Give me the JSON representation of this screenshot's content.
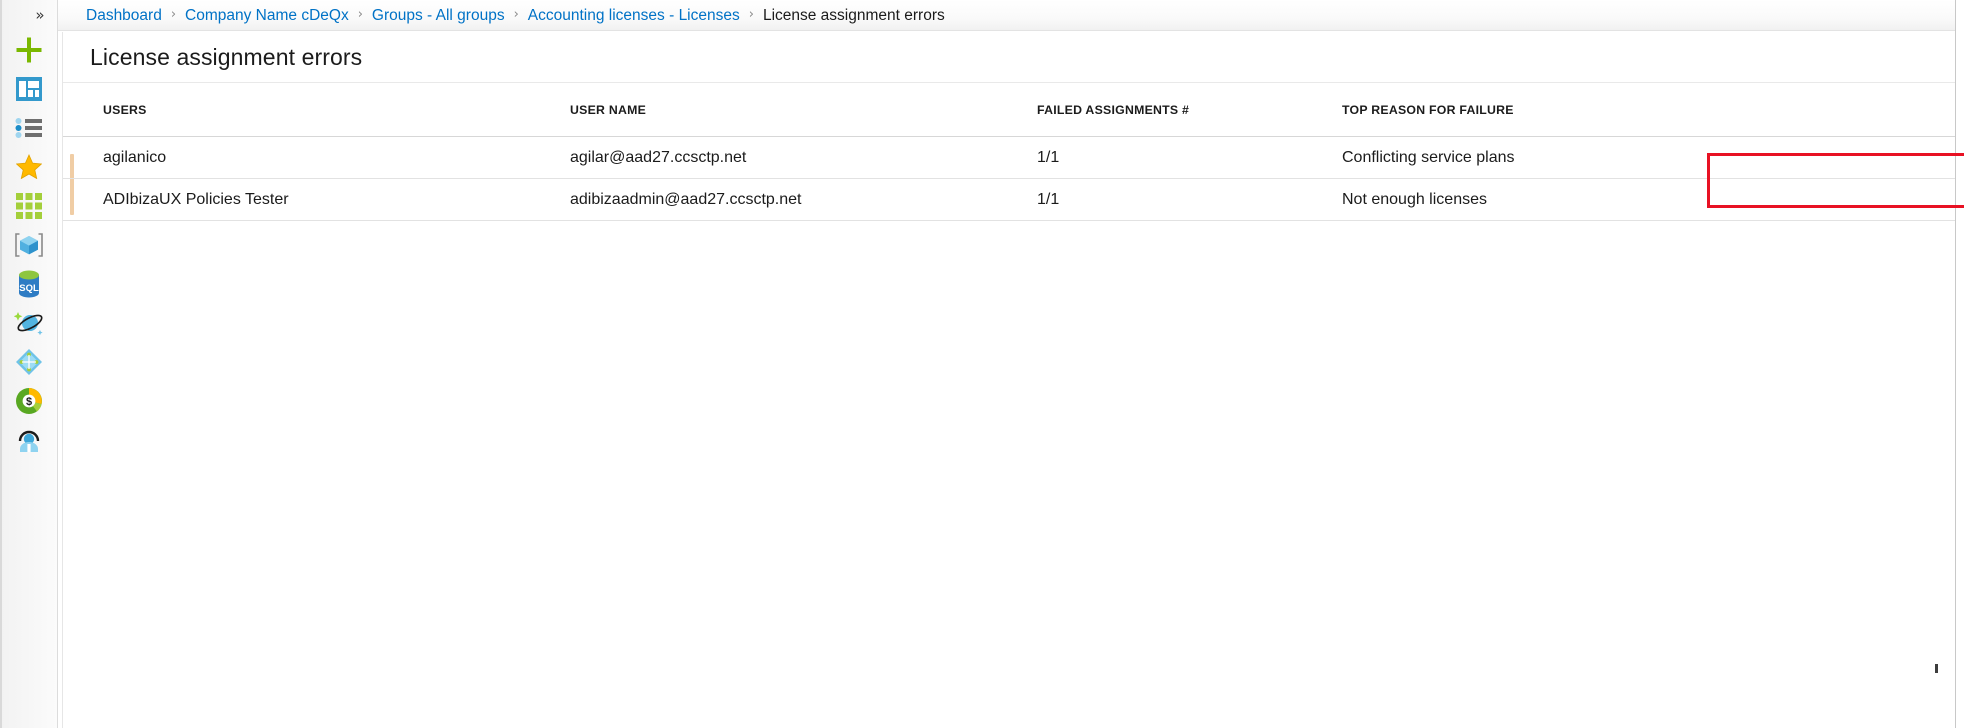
{
  "rail": {
    "collapse_label": "»",
    "items": [
      {
        "name": "create-resource",
        "icon": "plus-icon",
        "label": "Create a resource"
      },
      {
        "name": "dashboard",
        "icon": "dashboard-icon",
        "label": "Dashboard"
      },
      {
        "name": "all-services",
        "icon": "all-services-list-icon",
        "label": "All services"
      },
      {
        "name": "favorites",
        "icon": "star-icon",
        "label": "Favorites"
      },
      {
        "name": "all-resources",
        "icon": "grid-tiles-icon",
        "label": "All resources"
      },
      {
        "name": "resource-groups",
        "icon": "cube-box-icon",
        "label": "Resource groups"
      },
      {
        "name": "sql-databases",
        "icon": "sql-database-icon",
        "label": "SQL databases"
      },
      {
        "name": "azure-cosmos-db",
        "icon": "cosmos-db-planet-icon",
        "label": "Azure Cosmos DB"
      },
      {
        "name": "virtual-machines",
        "icon": "virtual-machine-diamond-icon",
        "label": "Virtual machines"
      },
      {
        "name": "cost-management",
        "icon": "cost-management-donut-icon",
        "label": "Cost Management + Billing"
      },
      {
        "name": "help-and-support",
        "icon": "help-support-headset-icon",
        "label": "Help + support"
      }
    ]
  },
  "breadcrumb": {
    "items": [
      {
        "label": "Dashboard",
        "current": false
      },
      {
        "label": "Company Name cDeQx",
        "current": false
      },
      {
        "label": "Groups - All groups",
        "current": false
      },
      {
        "label": "Accounting licenses - Licenses",
        "current": false
      },
      {
        "label": "License assignment errors",
        "current": true
      }
    ],
    "separator": "›"
  },
  "blade": {
    "title": "License assignment errors"
  },
  "grid": {
    "columns": [
      {
        "key": "users",
        "label": "USERS"
      },
      {
        "key": "uname",
        "label": "USER NAME"
      },
      {
        "key": "failed",
        "label": "FAILED ASSIGNMENTS #"
      },
      {
        "key": "reason",
        "label": "TOP REASON FOR FAILURE"
      }
    ],
    "rows": [
      {
        "users": "agilanico",
        "uname": "agilar@aad27.ccsctp.net",
        "failed": "1/1",
        "reason": "Conflicting service plans"
      },
      {
        "users": "ADIbizaUX Policies Tester",
        "uname": "adibizaadmin@aad27.ccsctp.net",
        "failed": "1/1",
        "reason": "Not enough licenses"
      }
    ]
  },
  "annotation": {
    "target": "Conflicting service plans",
    "color": "#e81123"
  },
  "colors": {
    "link": "#0072c6",
    "text": "#1b1b1b",
    "accent_green": "#7ab800",
    "accent_blue": "#3399cc",
    "annotation_red": "#e81123",
    "scroll_accent": "#f0cda5"
  }
}
